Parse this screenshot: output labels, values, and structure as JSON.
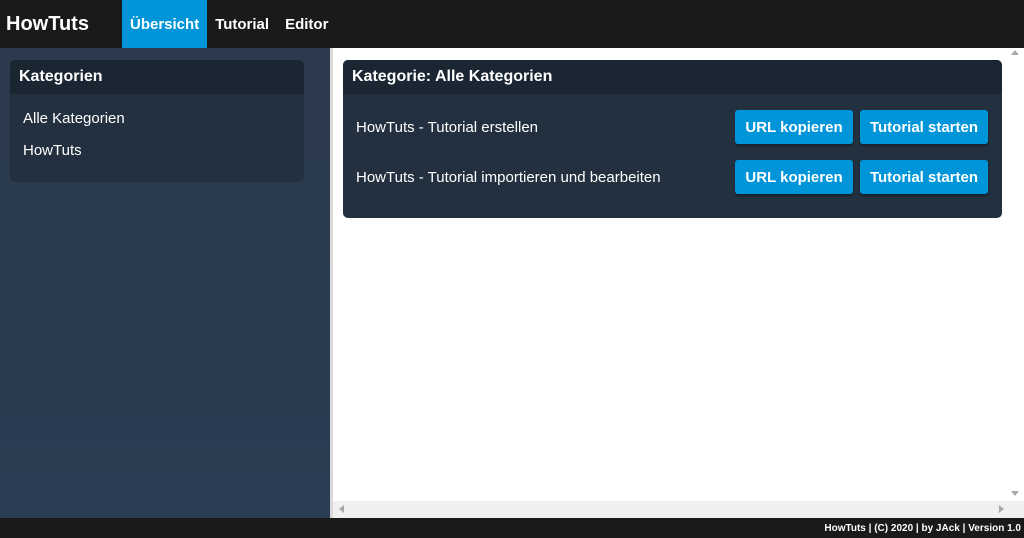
{
  "header": {
    "brand": "HowTuts",
    "nav": [
      {
        "label": "Übersicht",
        "active": true
      },
      {
        "label": "Tutorial",
        "active": false
      },
      {
        "label": "Editor",
        "active": false
      }
    ]
  },
  "sidebar": {
    "title": "Kategorien",
    "items": [
      {
        "label": "Alle Kategorien"
      },
      {
        "label": "HowTuts"
      }
    ]
  },
  "main": {
    "title": "Kategorie: Alle Kategorien",
    "tutorials": [
      {
        "title": "HowTuts - Tutorial erstellen",
        "copy_label": "URL kopieren",
        "start_label": "Tutorial starten"
      },
      {
        "title": "HowTuts - Tutorial importieren und bearbeiten",
        "copy_label": "URL kopieren",
        "start_label": "Tutorial starten"
      }
    ]
  },
  "footer": {
    "text": "HowTuts | (C) 2020 | by JAck | Version 1.0"
  },
  "colors": {
    "accent": "#0095d9",
    "topbar": "#1a1a1a",
    "panel": "#22303f",
    "panel_header": "#1b2633",
    "sidebar_bg": "#2b3a4c"
  },
  "icons": [
    "scroll-up-icon",
    "scroll-down-icon",
    "scroll-left-icon",
    "scroll-right-icon"
  ]
}
